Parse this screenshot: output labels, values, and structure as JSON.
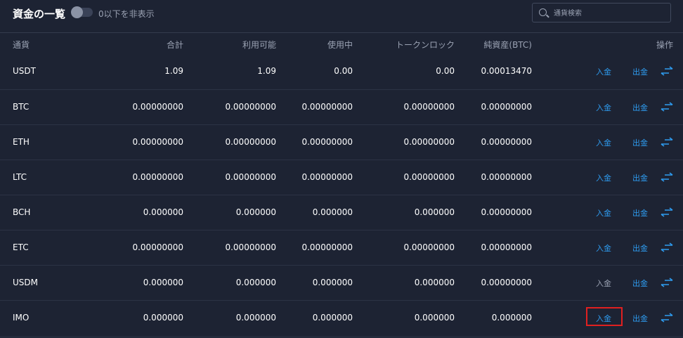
{
  "header": {
    "title": "資金の一覧",
    "toggle_label": "0以下を非表示",
    "search_placeholder": "通貨検索"
  },
  "columns": [
    "通貨",
    "合計",
    "利用可能",
    "使用中",
    "トークンロック",
    "純資産(BTC)",
    "操作"
  ],
  "actions": {
    "deposit": "入金",
    "withdraw": "出金"
  },
  "colors": {
    "background": "#1d2333",
    "accent": "#2e9cf0",
    "muted": "#9aa2b3",
    "highlight": "#e02020"
  },
  "rows": [
    {
      "currency": "USDT",
      "total": "1.09",
      "available": "1.09",
      "in_use": "0.00",
      "locked": "0.00",
      "btc": "0.00013470",
      "deposit_enabled": true
    },
    {
      "currency": "BTC",
      "total": "0.00000000",
      "available": "0.00000000",
      "in_use": "0.00000000",
      "locked": "0.00000000",
      "btc": "0.00000000",
      "deposit_enabled": true
    },
    {
      "currency": "ETH",
      "total": "0.00000000",
      "available": "0.00000000",
      "in_use": "0.00000000",
      "locked": "0.00000000",
      "btc": "0.00000000",
      "deposit_enabled": true
    },
    {
      "currency": "LTC",
      "total": "0.00000000",
      "available": "0.00000000",
      "in_use": "0.00000000",
      "locked": "0.00000000",
      "btc": "0.00000000",
      "deposit_enabled": true
    },
    {
      "currency": "BCH",
      "total": "0.000000",
      "available": "0.000000",
      "in_use": "0.000000",
      "locked": "0.000000",
      "btc": "0.00000000",
      "deposit_enabled": true
    },
    {
      "currency": "ETC",
      "total": "0.00000000",
      "available": "0.00000000",
      "in_use": "0.00000000",
      "locked": "0.00000000",
      "btc": "0.00000000",
      "deposit_enabled": true
    },
    {
      "currency": "USDM",
      "total": "0.000000",
      "available": "0.000000",
      "in_use": "0.000000",
      "locked": "0.000000",
      "btc": "0.00000000",
      "deposit_enabled": false
    },
    {
      "currency": "IMO",
      "total": "0.000000",
      "available": "0.000000",
      "in_use": "0.000000",
      "locked": "0.000000",
      "btc": "0.000000",
      "deposit_enabled": true,
      "highlighted": true
    }
  ]
}
